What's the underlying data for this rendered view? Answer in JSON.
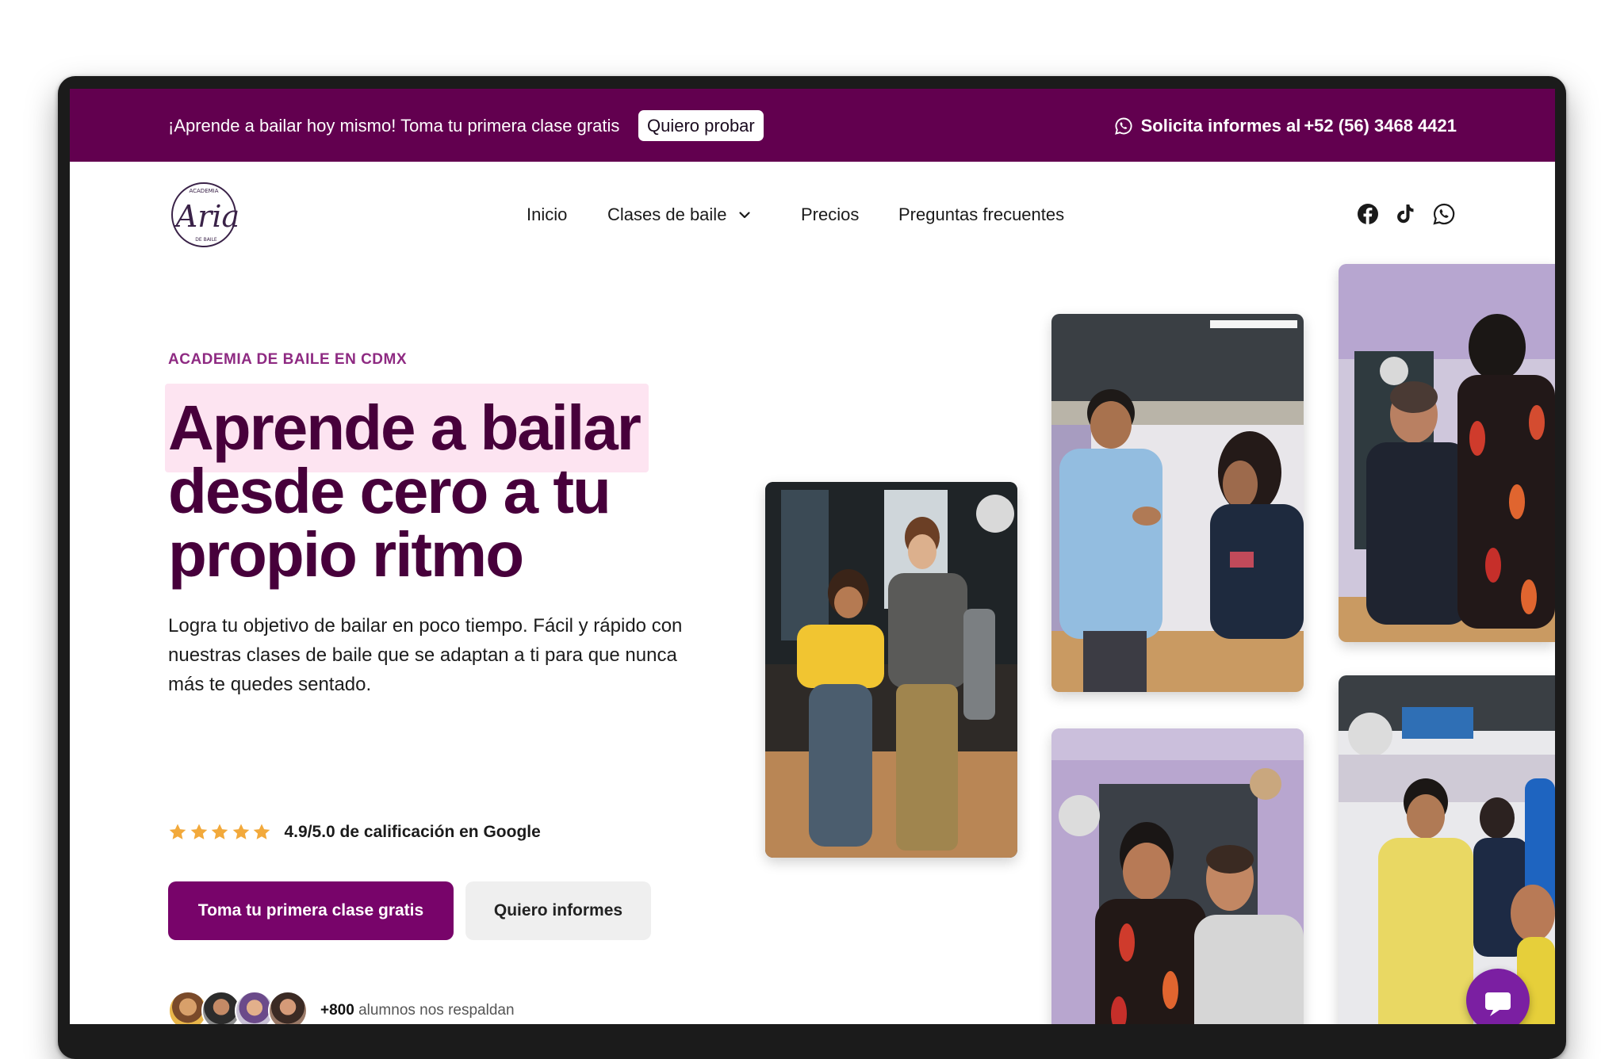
{
  "topbar": {
    "promo_text": "¡Aprende a bailar hoy mismo! Toma tu primera clase gratis",
    "promo_button": "Quiero probar",
    "contact_prefix": "Solicita informes al ",
    "contact_phone": "+52 (56) 3468 4421"
  },
  "brand": {
    "logo_text": "Aria",
    "logo_top": "ACADEMIA",
    "logo_bottom": "DE BAILE"
  },
  "nav": {
    "items": [
      "Inicio",
      "Clases de baile",
      "Precios",
      "Preguntas frecuentes"
    ]
  },
  "social_icons": [
    "facebook-icon",
    "tiktok-icon",
    "whatsapp-icon"
  ],
  "hero": {
    "eyebrow": "ACADEMIA DE BAILE EN CDMX",
    "title_lines": [
      "Aprende a bailar",
      "desde cero a tu",
      "propio ritmo"
    ],
    "lead": "Logra tu objetivo de bailar en poco tiempo. Fácil y rápido con nuestras clases de baile que se adaptan a ti para que nunca más te quedes sentado.",
    "rating_stars": 5,
    "rating_text": "4.9/5.0 de calificación en Google",
    "cta_primary": "Toma tu primera clase gratis",
    "cta_secondary": "Quiero informes",
    "students_count": "+800",
    "students_text": "alumnos nos respaldan"
  },
  "colors": {
    "brand_purple": "#62004f",
    "headline": "#47003b",
    "eyebrow": "#8e2a82",
    "highlight": "#fde4f1",
    "cta": "#78046a",
    "star": "#f2a93b"
  }
}
